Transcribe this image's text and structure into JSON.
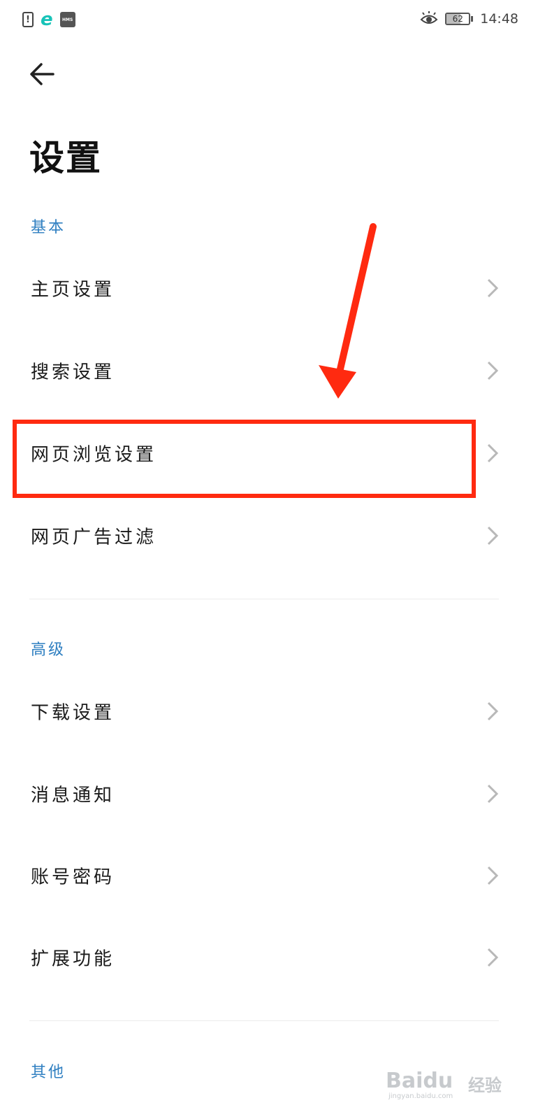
{
  "status_bar": {
    "battery_level": 62,
    "battery_text": "62",
    "time": "14:48",
    "left_icons": [
      "sim-alert-icon",
      "browser-e-icon",
      "hms-icon"
    ],
    "right_icons": [
      "eye-comfort-icon",
      "battery-icon"
    ]
  },
  "header": {
    "back_icon": "back-arrow-icon",
    "title": "设置"
  },
  "sections": [
    {
      "title": "基本",
      "items": [
        {
          "label": "主页设置"
        },
        {
          "label": "搜索设置"
        },
        {
          "label": "网页浏览设置",
          "highlighted": true
        },
        {
          "label": "网页广告过滤"
        }
      ]
    },
    {
      "title": "高级",
      "items": [
        {
          "label": "下载设置"
        },
        {
          "label": "消息通知"
        },
        {
          "label": "账号密码"
        },
        {
          "label": "扩展功能"
        }
      ]
    },
    {
      "title": "其他",
      "items": []
    }
  ],
  "annotation": {
    "color": "#ff2a10",
    "type": "red-arrow-and-box"
  },
  "watermark": {
    "brand": "Baidu",
    "label": "经验",
    "url": "jingyan.baidu.com"
  }
}
